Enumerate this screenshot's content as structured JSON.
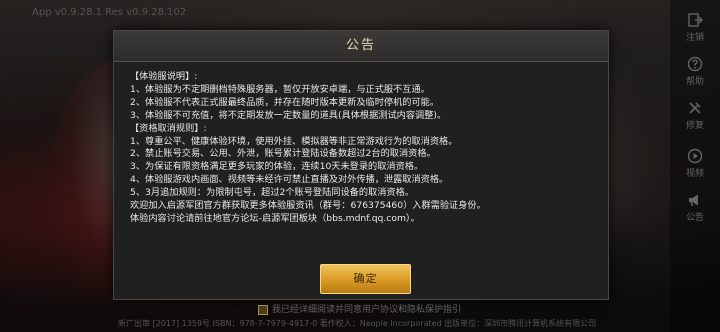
{
  "app": {
    "version_text": "App v0.9.28.1 Res v0.9.28.102"
  },
  "side_nav": {
    "items": [
      {
        "label": "注销",
        "icon": "logout-icon"
      },
      {
        "label": "帮助",
        "icon": "help-icon"
      },
      {
        "label": "修复",
        "icon": "repair-icon"
      },
      {
        "label": "视频",
        "icon": "video-icon"
      },
      {
        "label": "公告",
        "icon": "announcement-icon"
      }
    ]
  },
  "dialog": {
    "title": "公告",
    "lines": [
      "【体验服说明】:",
      "1、体验服为不定期删档特殊服务器，暂仅开放安卓端，与正式服不互通。",
      "2、体验服不代表正式服最终品质，并存在随时版本更新及临时停机的可能。",
      "3、体验服不可充值，将不定期发放一定数量的道具(具体根据测试内容调整)。",
      "【资格取消规则】:",
      "1、尊重公平、健康体验环境，使用外挂、模拟器等非正常游戏行为的取消资格。",
      "2、禁止账号交易、公用、外泄，账号累计登陆设备数超过2台的取消资格。",
      "3、为保证有限资格满足更多玩家的体验，连续10天未登录的取消资格。",
      "4、体验服游戏内画面、视频等未经许可禁止直播及对外传播，泄露取消资格。",
      "5、3月追加规则：为限制屯号，超过2个账号登陆同设备的取消资格。",
      "欢迎加入启源军团官方群获取更多体验服资讯（群号：676375460）入群需验证身份。",
      "体验内容讨论请前往地官方论坛-启源军团板块（bbs.mdnf.qq.com）。"
    ],
    "confirm_label": "确定"
  },
  "footer": {
    "agree_text": "我已经详细阅读并同意用户协议和隐私保护指引",
    "copyright": "新广出审 [2017] 1359号 ISBN：978-7-7979-4917-0 著作权人：Neople Incorporated 出版单位：深圳市腾讯计算机系统有限公司"
  },
  "colors": {
    "accent": "#e0a33a",
    "dialog_bg": "#202020",
    "title_text": "#e6d8b8"
  }
}
